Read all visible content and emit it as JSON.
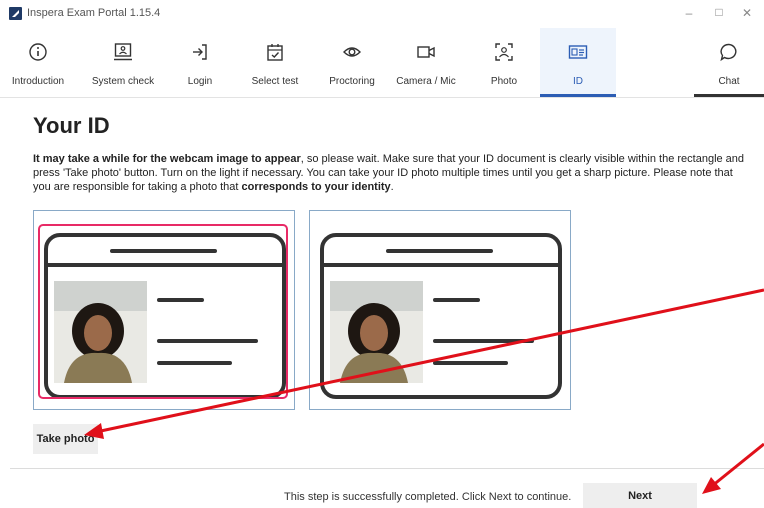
{
  "window": {
    "title": "Inspera Exam Portal 1.15.4",
    "controls": [
      "minimize-icon",
      "maximize-icon",
      "close-icon"
    ]
  },
  "nav": {
    "tabs": [
      {
        "label": "Introduction",
        "icon": "info-icon",
        "active": false
      },
      {
        "label": "System check",
        "icon": "monitor-person-icon",
        "active": false
      },
      {
        "label": "Login",
        "icon": "login-icon",
        "active": false
      },
      {
        "label": "Select test",
        "icon": "calendar-check-icon",
        "active": false
      },
      {
        "label": "Proctoring",
        "icon": "eye-icon",
        "active": false
      },
      {
        "label": "Camera / Mic",
        "icon": "video-camera-icon",
        "active": false
      },
      {
        "label": "Photo",
        "icon": "face-scan-icon",
        "active": false
      },
      {
        "label": "ID",
        "icon": "id-card-icon",
        "active": true
      }
    ],
    "chat": {
      "label": "Chat",
      "icon": "chat-bubble-icon"
    }
  },
  "main": {
    "title": "Your ID",
    "intro": {
      "bold1": "It may take a while for the webcam image to appear",
      "text1": ", so please wait. Make sure that your ID document is clearly visible within the rectangle and press 'Take photo' button. Turn on the light if necessary. You can take your ID photo multiple times until you get a sharp picture. Please note that you are responsible for taking a photo that ",
      "bold2": "corresponds to your identity",
      "text2": "."
    },
    "take_photo_label": "Take photo"
  },
  "footer": {
    "status": "This step is successfully completed. Click Next to continue.",
    "next_label": "Next"
  },
  "colors": {
    "accent": "#2c5db4",
    "overlay": "#e82a66",
    "panel_border": "#89a9c7",
    "annotation_arrow": "#e0101a"
  }
}
